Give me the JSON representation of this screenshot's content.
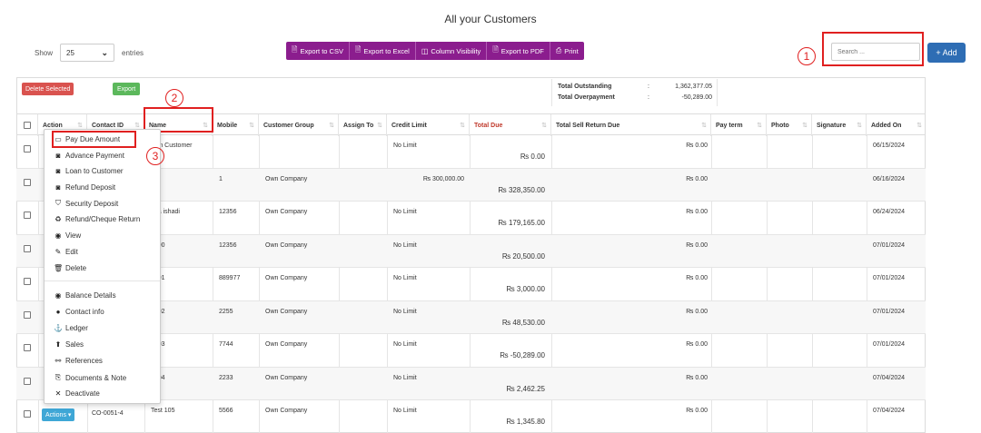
{
  "page": {
    "title": "All your Customers"
  },
  "length": {
    "show": "Show",
    "value": "25",
    "entries": "entries"
  },
  "exports": [
    {
      "label": "Export to CSV",
      "icon": "file-icon"
    },
    {
      "label": "Export to Excel",
      "icon": "file-excel-icon"
    },
    {
      "label": "Column Visibility",
      "icon": "columns-icon"
    },
    {
      "label": "Export to PDF",
      "icon": "file-pdf-icon"
    },
    {
      "label": "Print",
      "icon": "print-icon"
    }
  ],
  "search": {
    "placeholder": "Search ..."
  },
  "add": {
    "label": "Add"
  },
  "markers": [
    "1",
    "2",
    "3"
  ],
  "toolbar": {
    "delete_selected": "Delete Selected",
    "export": "Export"
  },
  "totals": {
    "outstanding_label": "Total Outstanding",
    "outstanding_value": "1,362,377.05",
    "overpayment_label": "Total Overpayment",
    "overpayment_value": "-50,289.00",
    "colon": ":"
  },
  "columns": [
    "Action",
    "Contact ID",
    "Name",
    "Mobile",
    "Customer Group",
    "Assign To",
    "Credit Limit",
    "Total Due",
    "Total Sell Return Due",
    "Pay term",
    "Photo",
    "Signature",
    "Added On"
  ],
  "rows": [
    {
      "name": "lk-In Customer",
      "mobile": "",
      "group": "",
      "credit": "No Limit",
      "due": "₨ 0.00",
      "ret": "₨ 0.00",
      "added": "06/15/2024"
    },
    {
      "name": "A",
      "mobile": "1",
      "group": "Own Company",
      "credit": "₨ 300,000.00",
      "due": "₨ 328,350.00",
      "ret": "₨ 0.00",
      "added": "06/16/2024"
    },
    {
      "name": "oda ishadi",
      "mobile": "12356",
      "group": "Own Company",
      "credit": "No Limit",
      "due": "₨ 179,165.00",
      "ret": "₨ 0.00",
      "added": "06/24/2024"
    },
    {
      "name": "t 100",
      "mobile": "12356",
      "group": "Own Company",
      "credit": "No Limit",
      "due": "₨ 20,500.00",
      "ret": "₨ 0.00",
      "added": "07/01/2024"
    },
    {
      "name": "t 101",
      "mobile": "889977",
      "group": "Own Company",
      "credit": "No Limit",
      "due": "₨ 3,000.00",
      "ret": "₨ 0.00",
      "added": "07/01/2024"
    },
    {
      "name": "t 102",
      "mobile": "2255",
      "group": "Own Company",
      "credit": "No Limit",
      "due": "₨ 48,530.00",
      "ret": "₨ 0.00",
      "added": "07/01/2024"
    },
    {
      "name": "t 103",
      "mobile": "7744",
      "group": "Own Company",
      "credit": "No Limit",
      "due": "₨ -50,289.00",
      "ret": "₨ 0.00",
      "added": "07/01/2024"
    },
    {
      "name": "t 104",
      "mobile": "2233",
      "group": "Own Company",
      "credit": "No Limit",
      "due": "₨ 2,462.25",
      "ret": "₨ 0.00",
      "added": "07/04/2024"
    },
    {
      "name": "Test 105",
      "mobile": "5566",
      "group": "Own Company",
      "credit": "No Limit",
      "due": "₨ 1,345.80",
      "ret": "₨ 0.00",
      "added": "07/04/2024",
      "contact": "CO-0051-4",
      "actions": "Actions ▾"
    }
  ],
  "menu": [
    {
      "label": "Pay Due Amount",
      "icon": "money-card-icon"
    },
    {
      "label": "Advance Payment",
      "icon": "money-bill-icon"
    },
    {
      "label": "Loan to Customer",
      "icon": "money-bill-icon"
    },
    {
      "label": "Refund Deposit",
      "icon": "money-bill-icon"
    },
    {
      "label": "Security Deposit",
      "icon": "shield-icon"
    },
    {
      "label": "Refund/Cheque Return",
      "icon": "recycle-icon"
    },
    {
      "label": "View",
      "icon": "eye-icon"
    },
    {
      "label": "Edit",
      "icon": "edit-icon"
    },
    {
      "label": "Delete",
      "icon": "trash-icon"
    },
    {
      "label": "Balance Details",
      "icon": "eye-icon"
    },
    {
      "label": "Contact info",
      "icon": "user-icon"
    },
    {
      "label": "Ledger",
      "icon": "anchor-icon"
    },
    {
      "label": "Sales",
      "icon": "arrow-circle-up-icon"
    },
    {
      "label": "References",
      "icon": "link-icon"
    },
    {
      "label": "Documents & Note",
      "icon": "paperclip-icon"
    },
    {
      "label": "Deactivate",
      "icon": "close-icon"
    }
  ],
  "colors": {
    "purple": "#8b1d8e",
    "blue": "#2e6db4",
    "red": "#e02020",
    "green": "#5cb85c",
    "danger": "#d9534f",
    "info": "#3fa7d6"
  }
}
